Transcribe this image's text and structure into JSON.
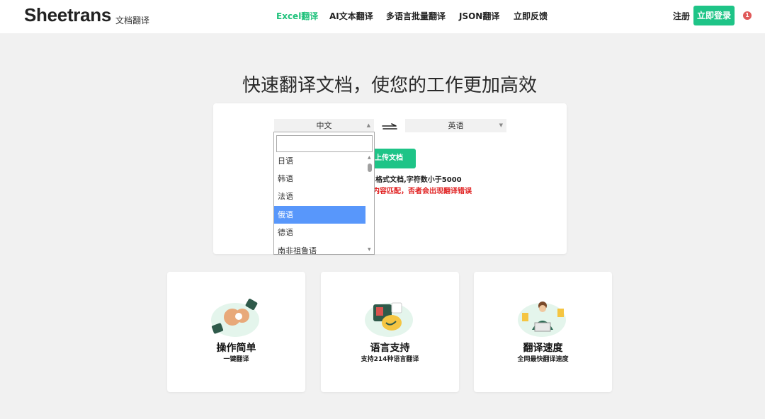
{
  "header": {
    "logo": "Sheetrans",
    "logo_sub": "文档翻译",
    "nav": [
      "Excel翻译",
      "AI文本翻译",
      "多语言批量翻译",
      "JSON翻译",
      "立即反馈"
    ],
    "register": "注册",
    "login": "立即登录",
    "notification_count": "1"
  },
  "hero": {
    "title": "快速翻译文档，使您的工作更加高效"
  },
  "translator": {
    "source_lang": "中文",
    "target_lang": "英语",
    "upload_label": "上传文档",
    "note_format": "格式文档,字符数小于5000",
    "note_warning": "内容匹配，否者会出现翻译错误"
  },
  "dropdown": {
    "search_value": "",
    "options": [
      "日语",
      "韩语",
      "法语",
      "俄语",
      "德语",
      "南非祖鲁语"
    ],
    "highlighted": "俄语"
  },
  "features": [
    {
      "title": "操作简单",
      "subtitle": "一键翻译"
    },
    {
      "title": "语言支持",
      "subtitle": "支持214种语言翻译"
    },
    {
      "title": "翻译速度",
      "subtitle": "全网最快翻译速度"
    }
  ],
  "colors": {
    "accent": "#1ec487",
    "highlight": "#5897fb",
    "warning": "#e02020",
    "badge": "#e05a5a"
  },
  "icons": [
    "swap-arrow-icon",
    "hands-icon",
    "language-bubbles-icon",
    "translator-person-icon"
  ]
}
